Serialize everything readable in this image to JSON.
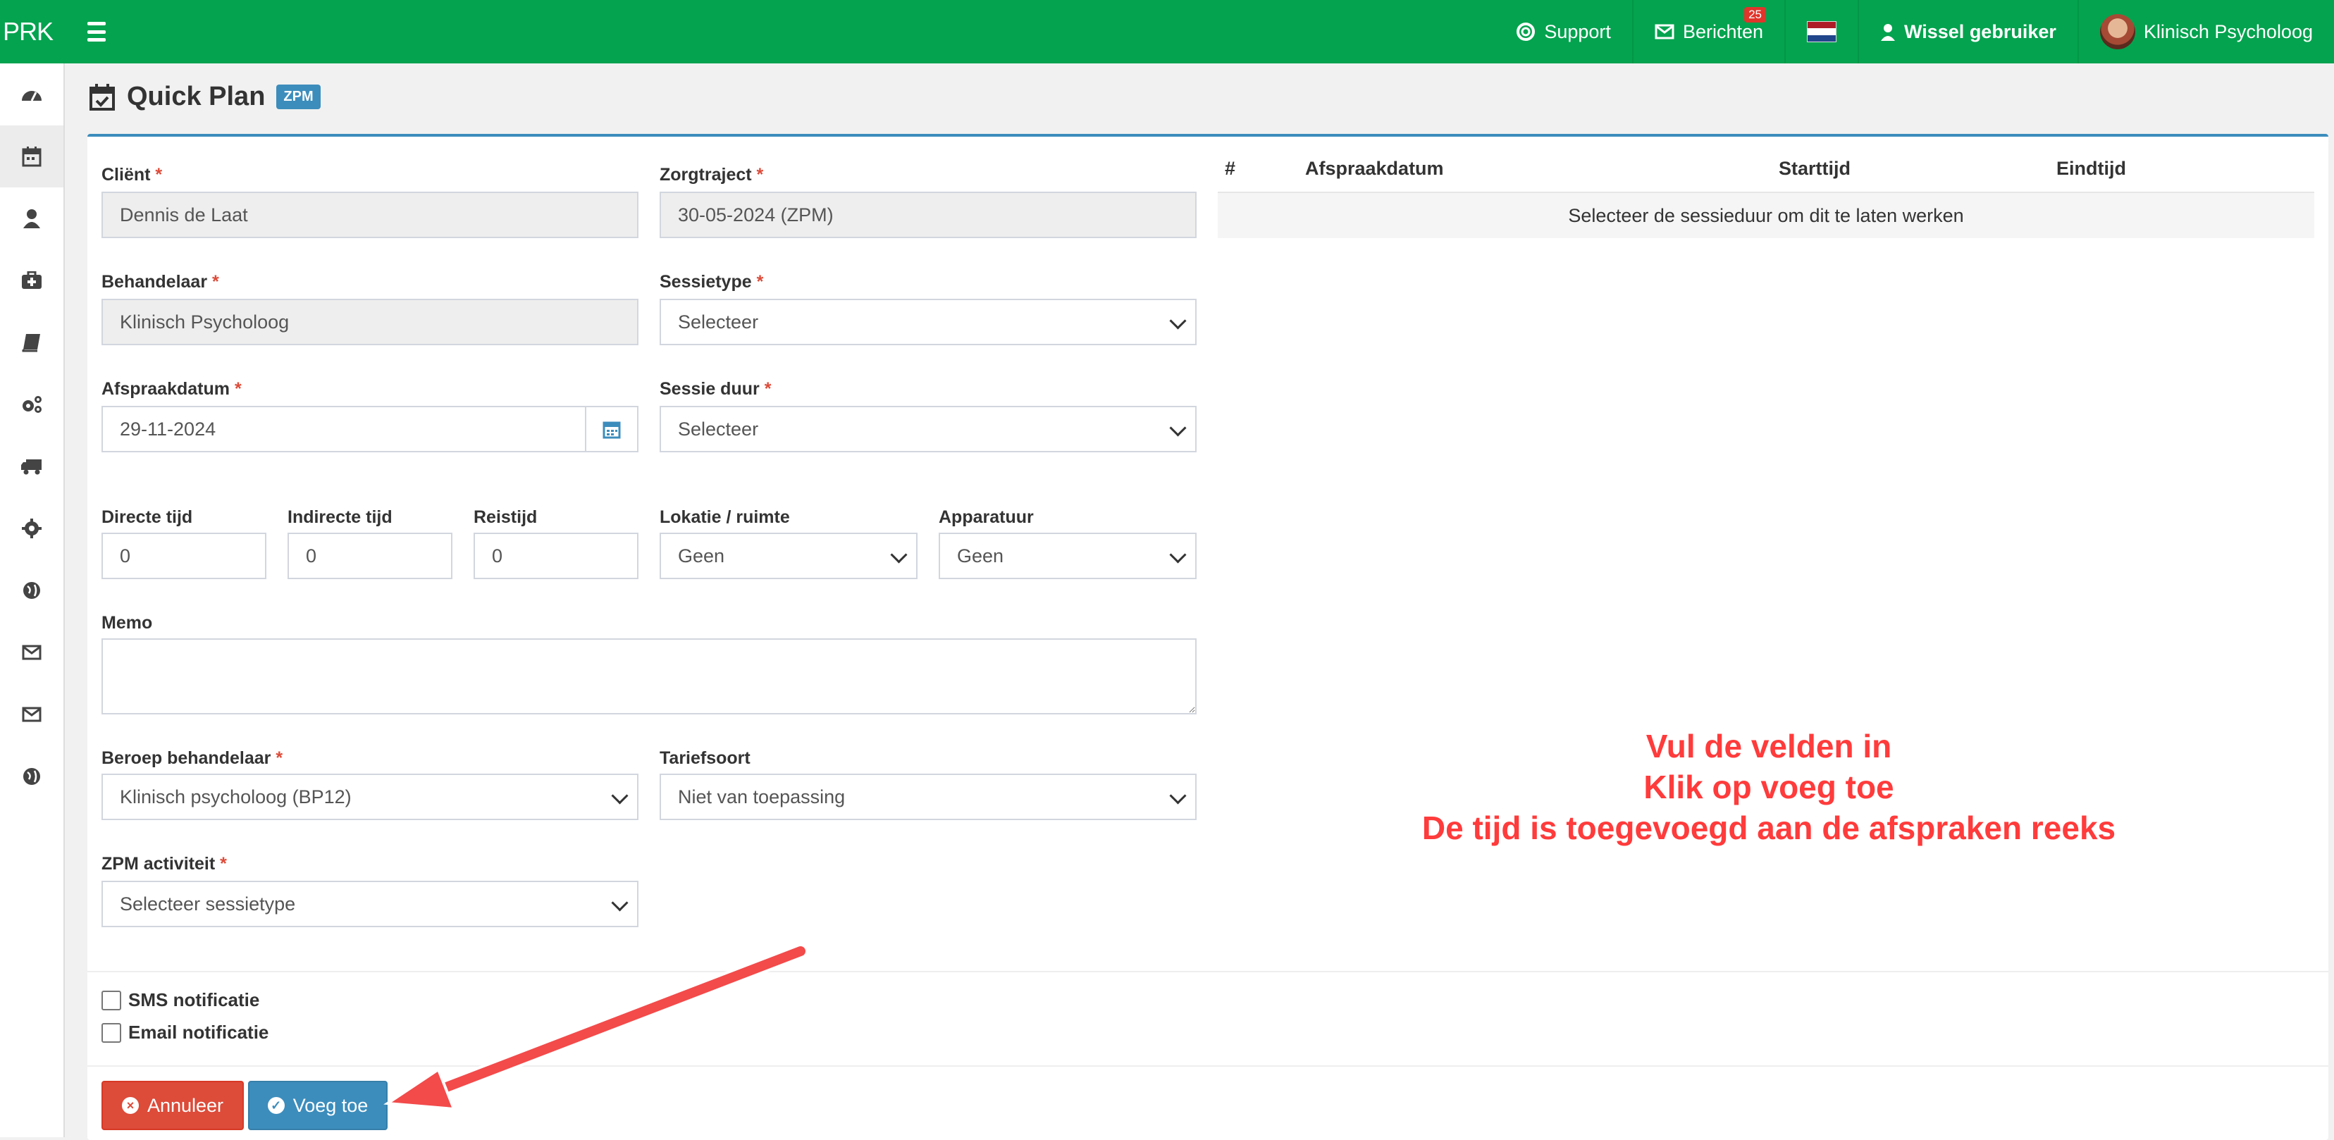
{
  "topbar": {
    "brand": "PRK",
    "support": "Support",
    "messages": "Berichten",
    "messages_count": "25",
    "switch_user": "Wissel gebruiker",
    "user_name": "Klinisch Psycholoog",
    "accent": "#04a34f"
  },
  "header": {
    "title": "Quick Plan",
    "badge": "ZPM"
  },
  "form": {
    "client_label": "Cliënt",
    "client_value": "Dennis de Laat",
    "trajectory_label": "Zorgtraject",
    "trajectory_value": "30-05-2024 (ZPM)",
    "practitioner_label": "Behandelaar",
    "practitioner_value": "Klinisch Psycholoog",
    "session_type_label": "Sessietype",
    "session_type_value": "Selecteer",
    "date_label": "Afspraakdatum",
    "date_value": "29-11-2024",
    "duration_label": "Sessie duur",
    "duration_value": "Selecteer",
    "direct_label": "Directe tijd",
    "direct_value": "0",
    "indirect_label": "Indirecte tijd",
    "indirect_value": "0",
    "travel_label": "Reistijd",
    "travel_value": "0",
    "location_label": "Lokatie / ruimte",
    "location_value": "Geen",
    "equipment_label": "Apparatuur",
    "equipment_value": "Geen",
    "memo_label": "Memo",
    "profession_label": "Beroep behandelaar",
    "profession_value": "Klinisch psycholoog (BP12)",
    "tariff_label": "Tariefsoort",
    "tariff_value": "Niet van toepassing",
    "zpm_label": "ZPM activiteit",
    "zpm_value": "Selecteer sessietype",
    "required_mark": "*",
    "sms_label": "SMS notificatie",
    "email_label": "Email notificatie",
    "cancel_label": "Annuleer",
    "add_label": "Voeg toe"
  },
  "table": {
    "headers": [
      "#",
      "Afspraakdatum",
      "Starttijd",
      "Eindtijd"
    ],
    "empty_message": "Selecteer de sessieduur om dit te laten werken"
  },
  "annotation": {
    "line1": "Vul de velden in",
    "line2": "Klik op voeg toe",
    "line3": "De tijd is toegevoegd aan de afspraken reeks"
  }
}
